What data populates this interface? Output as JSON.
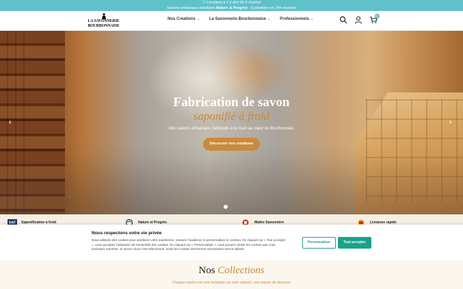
{
  "topbar": {
    "line1": "☐ Livraison à 1 € dès 60 € d'achat",
    "line2_prefix": "Savons artisanaux labellisés",
    "line2_bold": "Nature & Progrès",
    "line2_suffix": "-   Expédition en 24h ouvrées"
  },
  "logo": {
    "line1": "LA SAVONNERIE",
    "line2": "BOURBONNAISE"
  },
  "nav": [
    {
      "label": "Nos Créations"
    },
    {
      "label": "La Savonnerie Bourbonnaise"
    },
    {
      "label": "Professionnels"
    }
  ],
  "header_icons": {
    "search": "search-icon",
    "account": "user-icon",
    "cart": "cart-icon",
    "cart_count": "0"
  },
  "hero": {
    "title": "Fabrication de savon",
    "subtitle": "saponifié à froid",
    "description": "Des savons artisanaux, fabriqués à la main au cœur du Bourbonnais.",
    "button": "Découvrir nos créations",
    "prev": "‹",
    "next": "›"
  },
  "features": [
    {
      "label": "Saponification à froid",
      "icon": "saf-icon",
      "badge": "SAF"
    },
    {
      "label": "Nature et Progrès",
      "icon": "nature-progres-icon"
    },
    {
      "label": "Maître Savonnière",
      "icon": "maitre-savonniere-icon"
    },
    {
      "label": "Livraison rapide",
      "icon": "delivery-icon"
    }
  ],
  "cookie": {
    "title": "Nous respectons votre vie privée",
    "text": "Nous utilisons des cookies pour améliorer votre expérience, mesurer l'audience et personnaliser le contenu. En cliquant sur « Tout accepter », vous acceptez l'utilisation de l'ensemble des cookies. En cliquant sur « Personnaliser », vous pouvez choisir les cookies que vous souhaitez autoriser. Si aucun choix n'est sélectionné, seuls les cookies strictement nécessaires seront utilisés.",
    "customize": "Personnaliser",
    "accept_all": "Tout accepter"
  },
  "collections": {
    "title_plain": "Nos",
    "title_highlight": "Collections",
    "description": "Chaque savon est une invitation au soin naturel, une pause de douceur"
  },
  "colors": {
    "accent": "#5fc1c9",
    "gold": "#c98a3a",
    "green": "#1aa389"
  }
}
